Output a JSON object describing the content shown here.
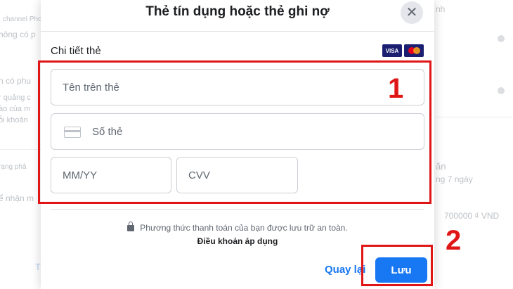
{
  "background": {
    "left_texts": [
      "channel Photo",
      "hông có p",
      "n có phu",
      "r quảng c",
      "ào của m",
      "ỗi khoản",
      "rạng phả",
      "ể nhận m",
      "T"
    ],
    "right_texts": [
      "nh",
      "ăn",
      "ng 7 ngày",
      "700000 ₫ VND"
    ]
  },
  "dialog": {
    "title": "Thẻ tín dụng hoặc thẻ ghi nợ",
    "close_symbol": "✕",
    "section_label": "Chi tiết thẻ",
    "card_brands": [
      "VISA",
      "Mastercard"
    ],
    "fields": {
      "name_placeholder": "Tên trên thẻ",
      "number_placeholder": "Số thẻ",
      "expiry_placeholder": "MM/YY",
      "cvv_placeholder": "CVV"
    },
    "secure_note": "Phương thức thanh toán của bạn được lưu trữ an toàn.",
    "terms_link": "Điều khoản áp dụng",
    "back_label": "Quay lại",
    "save_label": "Lưu"
  },
  "annotations": {
    "step1": "1",
    "step2": "2",
    "color": "#e01616"
  },
  "colors": {
    "primary": "#1877f2",
    "text": "#1c1e21",
    "muted": "#606770"
  }
}
